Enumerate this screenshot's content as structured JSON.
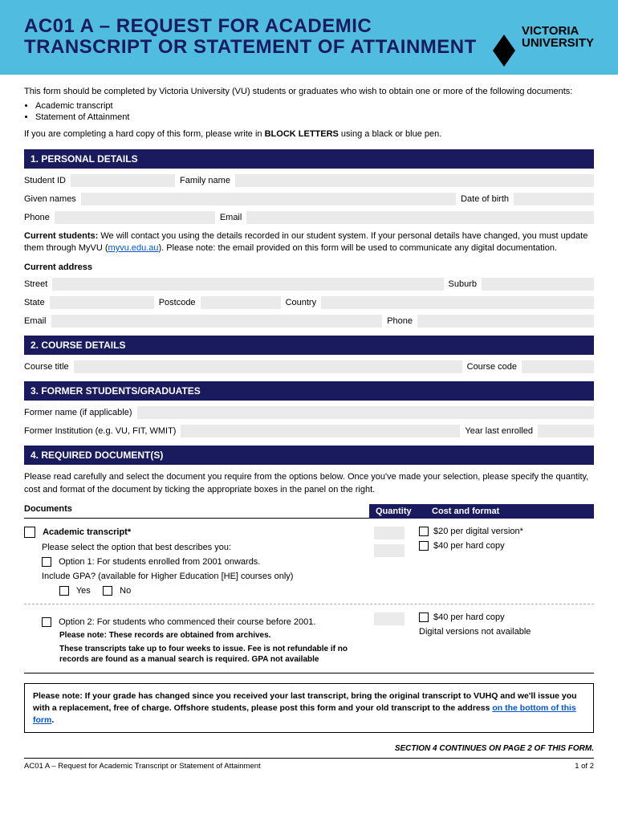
{
  "header": {
    "title_line1": "AC01 A – REQUEST FOR ACADEMIC",
    "title_line2": "TRANSCRIPT OR STATEMENT OF ATTAINMENT",
    "logo_line1": "VICTORIA",
    "logo_line2": "UNIVERSITY"
  },
  "intro": {
    "p1": "This form should be completed by Victoria University (VU) students or graduates who wish to obtain one or more of the following documents:",
    "bullet1": "Academic transcript",
    "bullet2": "Statement of Attainment",
    "hardcopy_prefix": "If you are completing a hard copy of this form, please write in ",
    "hardcopy_bold": "BLOCK LETTERS",
    "hardcopy_suffix": " using a black or blue pen."
  },
  "sections": {
    "s1": "1.  PERSONAL DETAILS",
    "s2": "2.  COURSE DETAILS",
    "s3": "3.  FORMER STUDENTS/GRADUATES",
    "s4": "4.  REQUIRED DOCUMENT(S)"
  },
  "personal": {
    "student_id": "Student ID",
    "family_name": "Family name",
    "given_names": "Given names",
    "dob": "Date of birth",
    "phone": "Phone",
    "email": "Email",
    "note_bold": "Current students:",
    "note_text1": " We will contact you using the details recorded in our student system. If your personal details have changed, you must update them through MyVU (",
    "note_link": "myvu.edu.au",
    "note_text2": "). Please note: the email provided on this form will be used to communicate any digital documentation.",
    "current_address": "Current address",
    "street": "Street",
    "suburb": "Suburb",
    "state": "State",
    "postcode": "Postcode",
    "country": "Country",
    "email2": "Email",
    "phone2": "Phone"
  },
  "course": {
    "title": "Course title",
    "code": "Course code"
  },
  "former": {
    "former_name": "Former name (if applicable)",
    "former_inst": "Former Institution (e.g. VU, FIT, WMIT)",
    "year_last": "Year last enrolled"
  },
  "required": {
    "intro": "Please read carefully and select the document you require from the options below. Once you've made your selection, please specify the quantity, cost and format of the document by ticking the appropriate boxes in the panel on the right.",
    "col_documents": "Documents",
    "col_quantity": "Quantity",
    "col_cost": "Cost and format",
    "academic_transcript": "Academic transcript*",
    "please_select": "Please select the option that best describes you:",
    "option1": "Option 1: For students enrolled from 2001 onwards.",
    "include_gpa": "Include GPA? (available for Higher Education [HE] courses only)",
    "yes": "Yes",
    "no": "No",
    "option2": "Option 2: For students who commenced their course before 2001.",
    "opt2_note1": "Please note: These records are obtained from archives.",
    "opt2_note2": "These transcripts take up to four weeks to issue. Fee is not refundable if no records are found as a manual search is required. GPA not available",
    "cost_digital": "$20 per digital version*",
    "cost_hard1": "$40 per hard copy",
    "cost_hard2": "$40 per hard copy",
    "digital_na": "Digital versions not available",
    "please_note_prefix": "Please note: If your grade has changed since you received your last transcript, bring the original transcript to VUHQ and we'll issue you with a replacement, free of charge. Offshore students, please post this form and your old transcript to the address ",
    "please_note_link": "on the bottom of this form",
    "please_note_suffix": "."
  },
  "footer": {
    "continues": "SECTION 4 CONTINUES ON PAGE 2 OF THIS FORM.",
    "doc_title": "AC01 A – Request for Academic Transcript or Statement of Attainment",
    "page": "1 of 2"
  }
}
